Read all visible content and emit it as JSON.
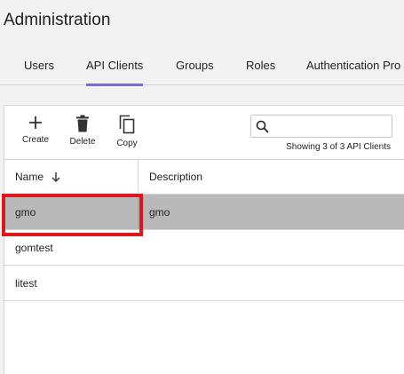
{
  "page": {
    "title": "Administration"
  },
  "tabs": [
    {
      "label": "Users",
      "active": false
    },
    {
      "label": "API Clients",
      "active": true
    },
    {
      "label": "Groups",
      "active": false
    },
    {
      "label": "Roles",
      "active": false
    },
    {
      "label": "Authentication Pro",
      "active": false
    }
  ],
  "toolbar": {
    "create_label": "Create",
    "delete_label": "Delete",
    "copy_label": "Copy",
    "icons": {
      "create": "plus-icon",
      "delete": "trash-icon",
      "copy": "copy-icon"
    }
  },
  "search": {
    "value": "",
    "placeholder": "",
    "icon": "search-icon"
  },
  "status": {
    "count_text": "Showing 3 of 3 API Clients"
  },
  "table": {
    "columns": [
      {
        "label": "Name",
        "sort": "descending"
      },
      {
        "label": "Description"
      }
    ],
    "rows": [
      {
        "name": "gmo",
        "description": "gmo",
        "selected": true
      },
      {
        "name": "gomtest",
        "description": "",
        "selected": false
      },
      {
        "name": "litest",
        "description": "",
        "selected": false
      }
    ]
  },
  "colors": {
    "accent": "#7b6fc4",
    "selected_row": "#b9b9b9",
    "highlight": "#e0161e",
    "background": "#f2f2f2"
  }
}
